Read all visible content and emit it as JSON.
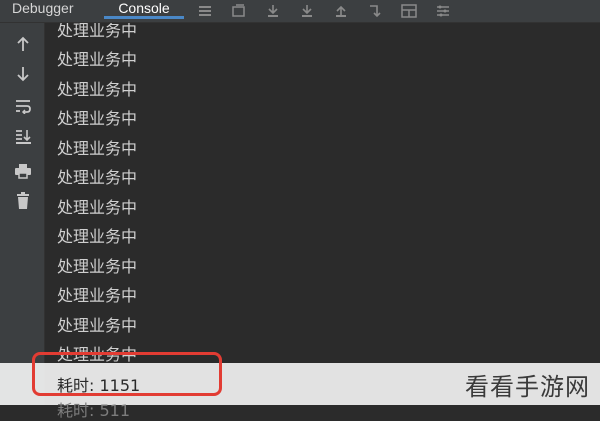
{
  "tabs": {
    "debugger": "Debugger",
    "console": "Console"
  },
  "toolbar_icons": [
    "menu-icon",
    "restore-layout-icon",
    "step-over-icon",
    "step-into-icon",
    "step-out-icon",
    "run-to-cursor-icon",
    "evaluate-icon",
    "settings-icon"
  ],
  "gutter_icons": [
    "up-arrow-icon",
    "down-arrow-icon",
    "soft-wrap-icon",
    "scroll-to-end-icon",
    "print-icon",
    "trash-icon"
  ],
  "console_lines": [
    "处理业务中",
    "处理业务中",
    "处理业务中",
    "处理业务中",
    "处理业务中",
    "处理业务中",
    "处理业务中",
    "处理业务中",
    "处理业务中",
    "处理业务中",
    "处理业务中",
    "处理业务中"
  ],
  "timing_line": "耗时: 1151",
  "cut_line": "耗时: 511",
  "watermark": "看看手游网",
  "colors": {
    "accent": "#4a88c7",
    "highlight_box": "#e23c33",
    "background": "#2b2b2b",
    "panel": "#3c3f41"
  }
}
